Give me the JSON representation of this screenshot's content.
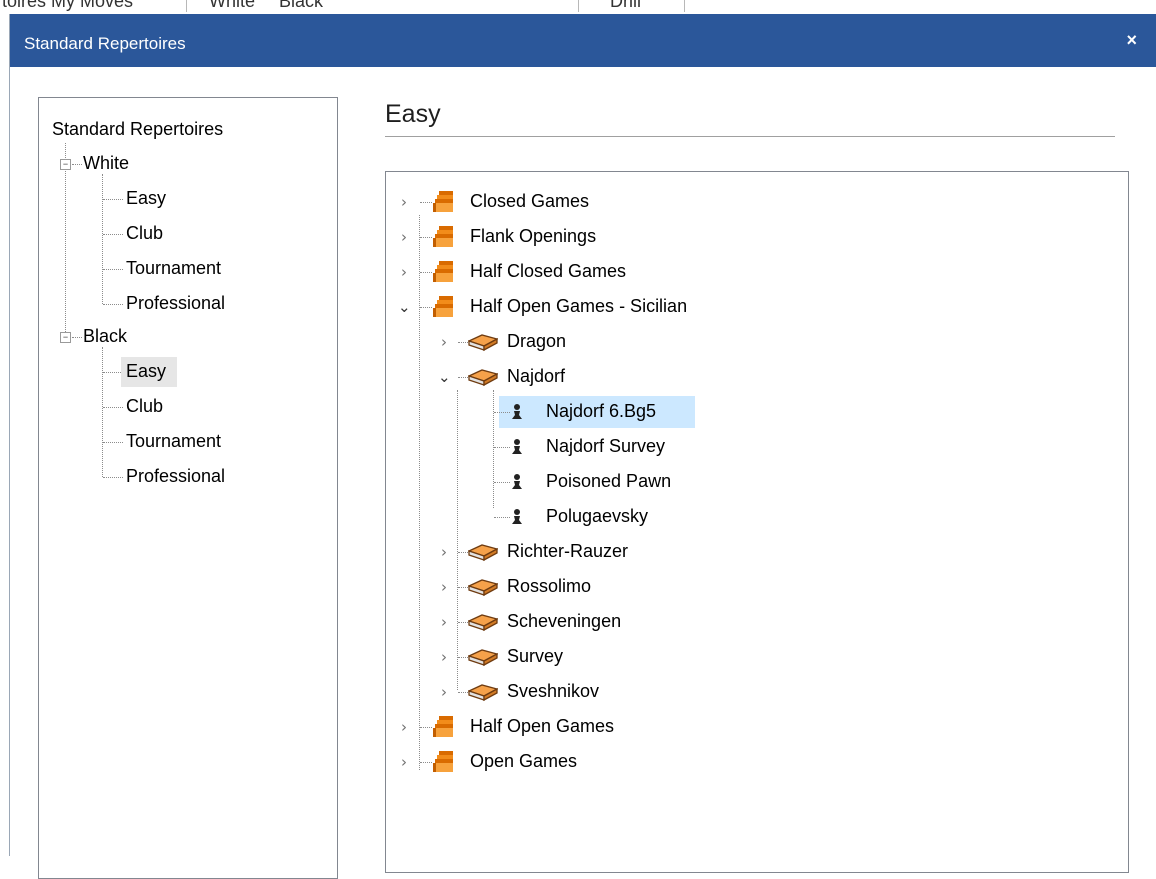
{
  "background": {
    "tabs": [
      "toires My Moves",
      "White",
      "Black",
      "Drill"
    ]
  },
  "dialog": {
    "title": "Standard Repertoires",
    "close_glyph": "×"
  },
  "left_tree": {
    "root": "Standard Repertoires",
    "groups": [
      {
        "label": "White",
        "items": [
          "Easy",
          "Club",
          "Tournament",
          "Professional"
        ]
      },
      {
        "label": "Black",
        "items": [
          "Easy",
          "Club",
          "Tournament",
          "Professional"
        ]
      }
    ],
    "selected": "Black/Easy"
  },
  "heading": "Easy",
  "right_tree": {
    "categories": [
      {
        "label": "Closed Games",
        "expanded": false
      },
      {
        "label": "Flank Openings",
        "expanded": false
      },
      {
        "label": "Half Closed Games",
        "expanded": false
      },
      {
        "label": "Half Open Games - Sicilian",
        "expanded": true,
        "children": [
          {
            "label": "Dragon",
            "expanded": false
          },
          {
            "label": "Najdorf",
            "expanded": true,
            "children": [
              "Najdorf 6.Bg5",
              "Najdorf Survey",
              "Poisoned Pawn",
              "Polugaevsky"
            ]
          },
          {
            "label": "Richter-Rauzer",
            "expanded": false
          },
          {
            "label": "Rossolimo",
            "expanded": false
          },
          {
            "label": "Scheveningen",
            "expanded": false
          },
          {
            "label": "Survey",
            "expanded": false
          },
          {
            "label": "Sveshnikov",
            "expanded": false
          }
        ]
      },
      {
        "label": "Half Open Games",
        "expanded": false
      },
      {
        "label": "Open Games",
        "expanded": false
      }
    ],
    "selected": "Najdorf 6.Bg5"
  },
  "icons": {
    "category": "book-stack-icon",
    "sub": "open-book-icon",
    "leaf": "pawn-icon",
    "collapsed": "chevron-right-icon",
    "expanded": "chevron-down-icon"
  },
  "colors": {
    "titlebar": "#2b579a",
    "selection": "#cce8ff",
    "book_orange": "#f28c1a"
  }
}
